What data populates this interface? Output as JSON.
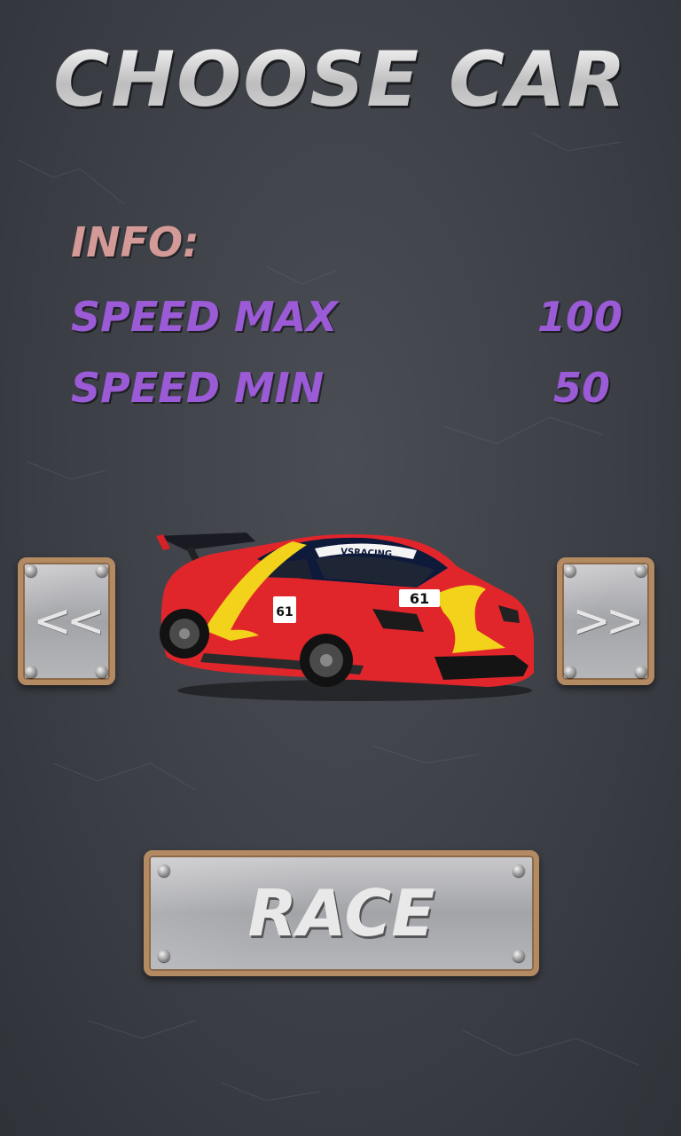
{
  "screen": {
    "title": "CHOOSE CAR"
  },
  "info": {
    "label": "INFO:",
    "stats": [
      {
        "name": "SPEED MAX",
        "value": "100"
      },
      {
        "name": "SPEED MIN",
        "value": "50"
      }
    ]
  },
  "car": {
    "number": "61",
    "windshield_text": "VSRACING",
    "side_text": "61"
  },
  "buttons": {
    "prev": "<<",
    "next": ">>",
    "race": "RACE"
  },
  "colors": {
    "title": "#e2e2e2",
    "info_label": "#d39a97",
    "stat_text": "#9b5bd6",
    "car_body": "#e0262b",
    "car_stripe": "#f2d21a"
  }
}
